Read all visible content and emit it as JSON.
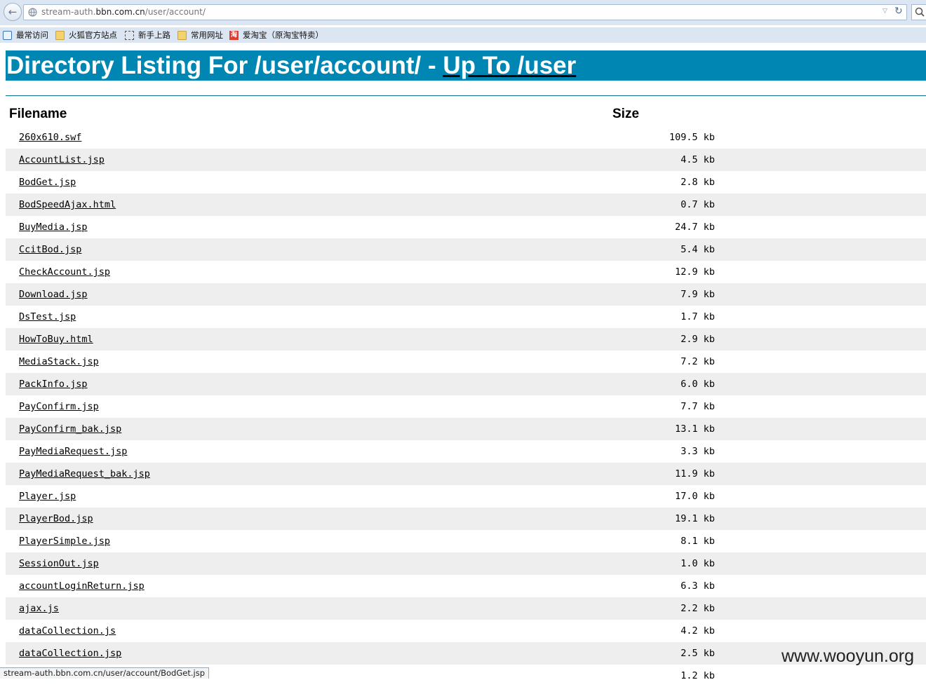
{
  "browser": {
    "url_prefix": "stream-auth.",
    "url_host": "bbn.com.cn",
    "url_path": "/user/account/",
    "bookmarks": [
      {
        "label": "最常访问",
        "icon": "most-visited-icon"
      },
      {
        "label": "火狐官方站点",
        "icon": "folder-icon"
      },
      {
        "label": "新手上路",
        "icon": "page-icon"
      },
      {
        "label": "常用网址",
        "icon": "folder-icon"
      },
      {
        "label": "爱淘宝（原淘宝特卖）",
        "icon": "taobao-icon",
        "icon_text": "淘"
      }
    ],
    "status_text": "stream-auth.bbn.com.cn/user/account/BodGet.jsp"
  },
  "page": {
    "title_prefix": "Directory Listing For /user/account/ - ",
    "up_link": "Up To /user",
    "header_color": "#0086b3",
    "columns": {
      "filename": "Filename",
      "size": "Size"
    },
    "files": [
      {
        "name": "260x610.swf",
        "size": "109.5 kb"
      },
      {
        "name": "AccountList.jsp",
        "size": "4.5 kb"
      },
      {
        "name": "BodGet.jsp",
        "size": "2.8 kb"
      },
      {
        "name": "BodSpeedAjax.html",
        "size": "0.7 kb"
      },
      {
        "name": "BuyMedia.jsp",
        "size": "24.7 kb"
      },
      {
        "name": "CcitBod.jsp",
        "size": "5.4 kb"
      },
      {
        "name": "CheckAccount.jsp",
        "size": "12.9 kb"
      },
      {
        "name": "Download.jsp",
        "size": "7.9 kb"
      },
      {
        "name": "DsTest.jsp",
        "size": "1.7 kb"
      },
      {
        "name": "HowToBuy.html",
        "size": "2.9 kb"
      },
      {
        "name": "MediaStack.jsp",
        "size": "7.2 kb"
      },
      {
        "name": "PackInfo.jsp",
        "size": "6.0 kb"
      },
      {
        "name": "PayConfirm.jsp",
        "size": "7.7 kb"
      },
      {
        "name": "PayConfirm_bak.jsp",
        "size": "13.1 kb"
      },
      {
        "name": "PayMediaRequest.jsp",
        "size": "3.3 kb"
      },
      {
        "name": "PayMediaRequest_bak.jsp",
        "size": "11.9 kb"
      },
      {
        "name": "Player.jsp",
        "size": "17.0 kb"
      },
      {
        "name": "PlayerBod.jsp",
        "size": "19.1 kb"
      },
      {
        "name": "PlayerSimple.jsp",
        "size": "8.1 kb"
      },
      {
        "name": "SessionOut.jsp",
        "size": "1.0 kb"
      },
      {
        "name": "accountLoginReturn.jsp",
        "size": "6.3 kb"
      },
      {
        "name": "ajax.js",
        "size": "2.2 kb"
      },
      {
        "name": "dataCollection.js",
        "size": "4.2 kb"
      },
      {
        "name": "dataCollection.jsp",
        "size": "2.5 kb"
      },
      {
        "name": "",
        "size": "1.2 kb"
      }
    ]
  },
  "watermark": "www.wooyun.org"
}
